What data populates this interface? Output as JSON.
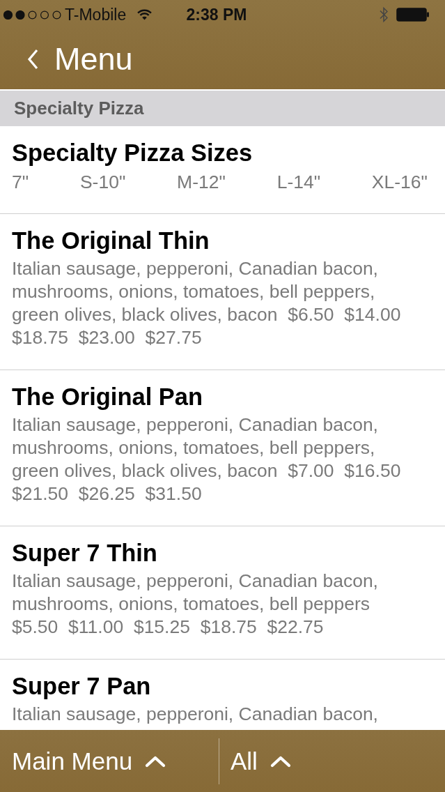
{
  "status_bar": {
    "carrier": "T-Mobile",
    "time": "2:38 PM"
  },
  "nav_bar": {
    "back_label": "Menu"
  },
  "section": {
    "title": "Specialty Pizza"
  },
  "sizes_card": {
    "title": "Specialty Pizza Sizes",
    "sizes": [
      "7\"",
      "S-10\"",
      "M-12\"",
      "L-14\"",
      "XL-16\""
    ]
  },
  "items": [
    {
      "name": "The Original Thin",
      "description": "Italian sausage, pepperoni, Canadian bacon, mushrooms, onions, tomatoes, bell peppers, green olives, black olives, bacon",
      "prices": [
        "$6.50",
        "$14.00",
        "$18.75",
        "$23.00",
        "$27.75"
      ]
    },
    {
      "name": "The Original Pan",
      "description": "Italian sausage, pepperoni, Canadian bacon, mushrooms, onions, tomatoes, bell peppers, green olives, black olives, bacon",
      "prices": [
        "$7.00",
        "$16.50",
        "$21.50",
        "$26.25",
        "$31.50"
      ]
    },
    {
      "name": "Super 7 Thin",
      "description": "Italian sausage, pepperoni, Canadian bacon, mushrooms, onions, tomatoes, bell peppers",
      "prices": [
        "$5.50",
        "$11.00",
        "$15.25",
        "$18.75",
        "$22.75"
      ]
    },
    {
      "name": "Super 7 Pan",
      "description": "Italian sausage, pepperoni, Canadian bacon,"
    }
  ],
  "bottom_bar": {
    "buttons": [
      {
        "label": "Main Menu"
      },
      {
        "label": "All"
      }
    ]
  }
}
